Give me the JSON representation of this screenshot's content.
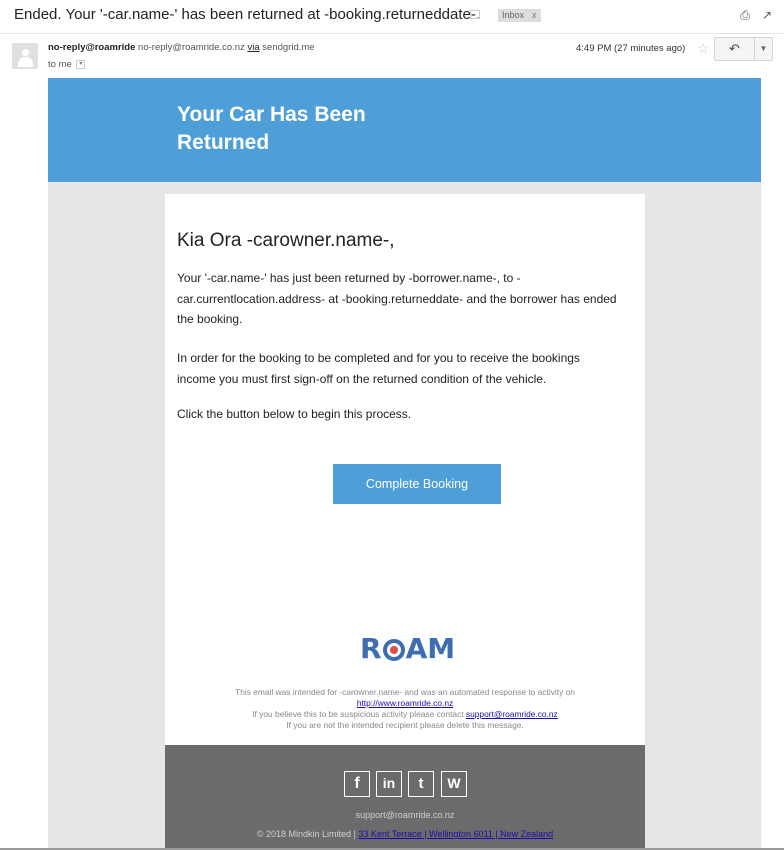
{
  "subject_bar": {
    "subject": "Ended. Your '-car.name-' has been returned at -booking.returneddate-.",
    "label": "Inbox",
    "label_close": "x",
    "print_icon": "print-icon",
    "popout_icon": "open-in-new-window-icon"
  },
  "message_header": {
    "sender_name": "no-reply@roamride",
    "sender_email": "no-reply@roamride.co.nz",
    "via_label": "via",
    "via_domain": "sendgrid.me",
    "to_text": "to me",
    "time": "4:49 PM (27 minutes ago)",
    "star_icon": "star-outline-icon",
    "reply_icon": "reply-icon",
    "more_icon": "chevron-down-icon"
  },
  "email": {
    "hero_title": "Your Car Has Been Returned",
    "hero_color": "#4e9fd8",
    "greeting": "Kia Ora -carowner.name-,",
    "paragraph1": "Your '-car.name-' has just been returned by -borrower.name-, to -car.currentlocation.address- at -booking.returneddate- and the borrower has ended the booking.",
    "paragraph2": "In order for the booking to be completed and for you to receive the bookings income you must first sign-off on the returned condition of the vehicle.",
    "paragraph3": "Click the button below to begin this process.",
    "cta_label": "Complete Booking",
    "logo_text_left": "R",
    "logo_text_right": "AM",
    "disclaimer_line1": "This email was intended for -carowner.name- and was an automated response to activity on",
    "disclaimer_link": "http://www.roamride.co.nz",
    "disclaimer_line2": "If you believe this to be suspicious activity please contact",
    "disclaimer_support": "support@roamride.co.nz",
    "disclaimer_line3": "If you are not the intended recipient please delete this message."
  },
  "footer": {
    "social_icons": [
      "facebook-icon",
      "linkedin-icon",
      "twitter-icon",
      "wordpress-icon"
    ],
    "facebook_glyph": "f",
    "linkedin_glyph": "in",
    "twitter_glyph": "t",
    "wordpress_glyph": "W",
    "email": "support@roamride.co.nz",
    "copyright": "© 2018 Mindkin Limited |",
    "address": "33 Kent Terrace | Wellington 6011 | New Zealand",
    "background": "#6b6b6b"
  }
}
